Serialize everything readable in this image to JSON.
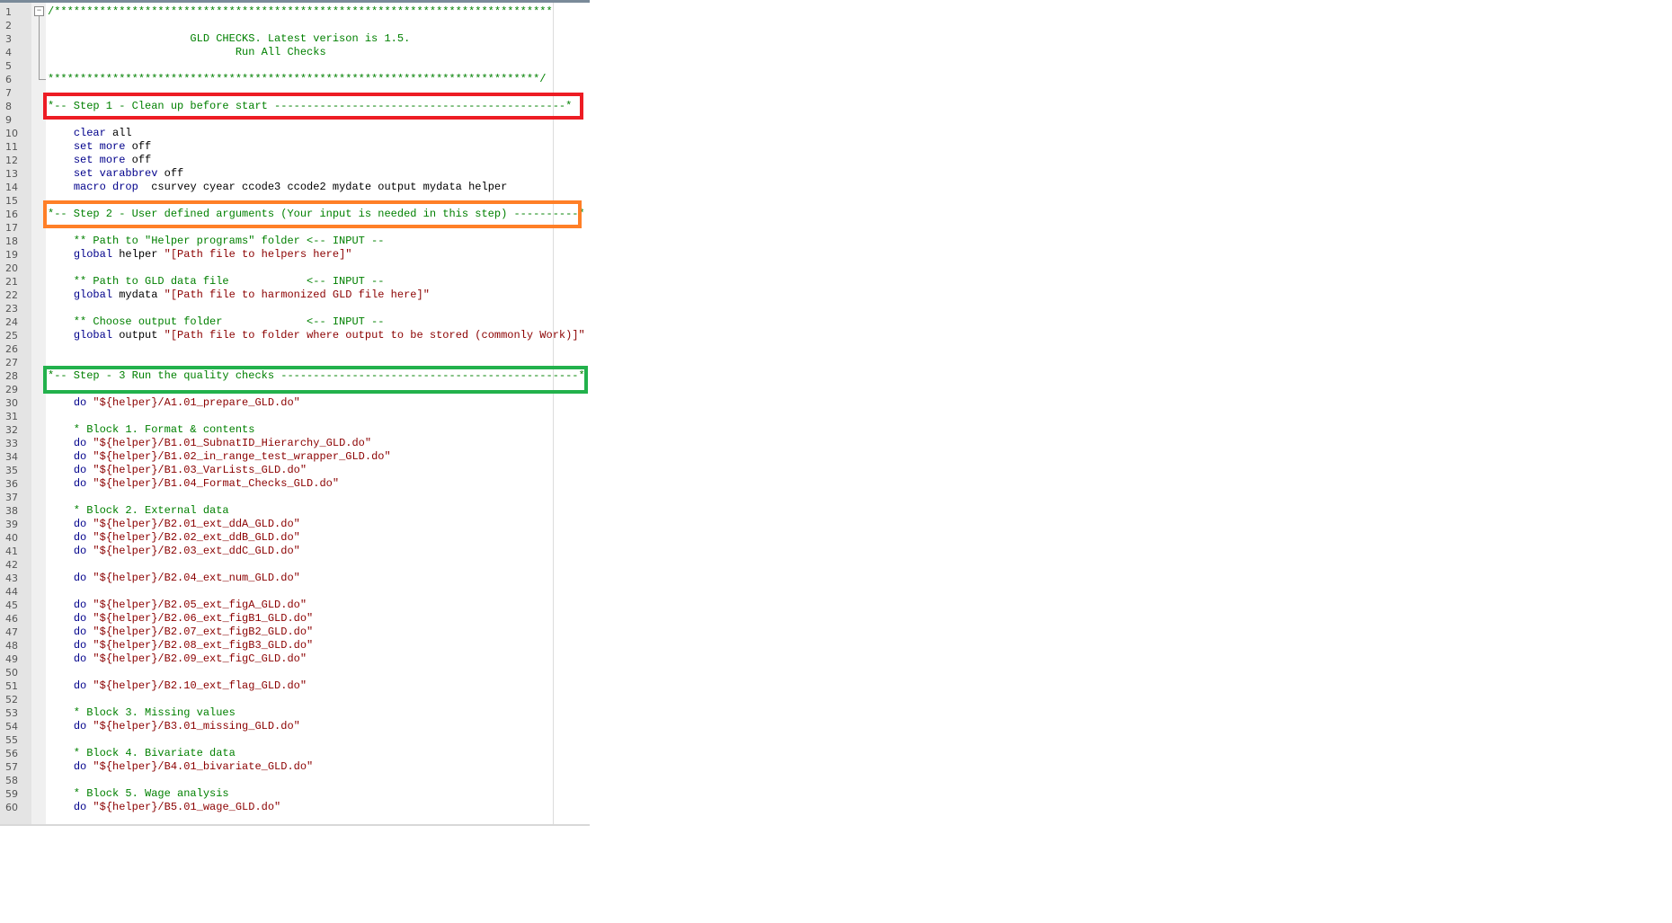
{
  "colors": {
    "comment": "#008000",
    "keyword": "#00008b",
    "string": "#8b0000",
    "step1_box": "#ed1c24",
    "step2_box": "#ff7f27",
    "step3_box": "#22b14c"
  },
  "lines": [
    [
      [
        "c",
        "/*****************************************************************************"
      ]
    ],
    [],
    [
      [
        "c",
        "                      GLD CHECKS. Latest verison is 1.5."
      ]
    ],
    [
      [
        "c",
        "                             Run All Checks"
      ]
    ],
    [],
    [
      [
        "c",
        "****************************************************************************/"
      ]
    ],
    [],
    [
      [
        "c",
        "*-- Step 1 - Clean up before start ---------------------------------------------*"
      ]
    ],
    [],
    [
      [
        "t",
        "    "
      ],
      [
        "k",
        "clear"
      ],
      [
        "t",
        " all"
      ]
    ],
    [
      [
        "t",
        "    "
      ],
      [
        "k",
        "set more"
      ],
      [
        "t",
        " off"
      ]
    ],
    [
      [
        "t",
        "    "
      ],
      [
        "k",
        "set more"
      ],
      [
        "t",
        " off"
      ]
    ],
    [
      [
        "t",
        "    "
      ],
      [
        "k",
        "set varabbrev"
      ],
      [
        "t",
        " off"
      ]
    ],
    [
      [
        "t",
        "    "
      ],
      [
        "k",
        "macro drop"
      ],
      [
        "t",
        "  csurvey cyear ccode3 ccode2 mydate output mydata helper"
      ]
    ],
    [],
    [
      [
        "c",
        "*-- Step 2 - User defined arguments (Your input is needed in this step) ----------*"
      ]
    ],
    [],
    [
      [
        "c",
        "    ** Path to \"Helper programs\" folder <-- INPUT --"
      ]
    ],
    [
      [
        "t",
        "    "
      ],
      [
        "k",
        "global"
      ],
      [
        "t",
        " helper "
      ],
      [
        "s",
        "\"[Path file to helpers here]\""
      ]
    ],
    [],
    [
      [
        "c",
        "    ** Path to GLD data file            <-- INPUT --"
      ]
    ],
    [
      [
        "t",
        "    "
      ],
      [
        "k",
        "global"
      ],
      [
        "t",
        " mydata "
      ],
      [
        "s",
        "\"[Path file to harmonized GLD file here]\""
      ]
    ],
    [],
    [
      [
        "c",
        "    ** Choose output folder             <-- INPUT --"
      ]
    ],
    [
      [
        "t",
        "    "
      ],
      [
        "k",
        "global"
      ],
      [
        "t",
        " output "
      ],
      [
        "s",
        "\"[Path file to folder where output to be stored (commonly Work)]\""
      ]
    ],
    [],
    [],
    [
      [
        "c",
        "*-- Step - 3 Run the quality checks ----------------------------------------------*"
      ]
    ],
    [],
    [
      [
        "t",
        "    "
      ],
      [
        "k",
        "do"
      ],
      [
        "t",
        " "
      ],
      [
        "s",
        "\"${helper}/A1.01_prepare_GLD.do\""
      ]
    ],
    [],
    [
      [
        "c",
        "    * Block 1. Format & contents"
      ]
    ],
    [
      [
        "t",
        "    "
      ],
      [
        "k",
        "do"
      ],
      [
        "t",
        " "
      ],
      [
        "s",
        "\"${helper}/B1.01_SubnatID_Hierarchy_GLD.do\""
      ]
    ],
    [
      [
        "t",
        "    "
      ],
      [
        "k",
        "do"
      ],
      [
        "t",
        " "
      ],
      [
        "s",
        "\"${helper}/B1.02_in_range_test_wrapper_GLD.do\""
      ]
    ],
    [
      [
        "t",
        "    "
      ],
      [
        "k",
        "do"
      ],
      [
        "t",
        " "
      ],
      [
        "s",
        "\"${helper}/B1.03_VarLists_GLD.do\""
      ]
    ],
    [
      [
        "t",
        "    "
      ],
      [
        "k",
        "do"
      ],
      [
        "t",
        " "
      ],
      [
        "s",
        "\"${helper}/B1.04_Format_Checks_GLD.do\""
      ]
    ],
    [],
    [
      [
        "c",
        "    * Block 2. External data"
      ]
    ],
    [
      [
        "t",
        "    "
      ],
      [
        "k",
        "do"
      ],
      [
        "t",
        " "
      ],
      [
        "s",
        "\"${helper}/B2.01_ext_ddA_GLD.do\""
      ]
    ],
    [
      [
        "t",
        "    "
      ],
      [
        "k",
        "do"
      ],
      [
        "t",
        " "
      ],
      [
        "s",
        "\"${helper}/B2.02_ext_ddB_GLD.do\""
      ]
    ],
    [
      [
        "t",
        "    "
      ],
      [
        "k",
        "do"
      ],
      [
        "t",
        " "
      ],
      [
        "s",
        "\"${helper}/B2.03_ext_ddC_GLD.do\""
      ]
    ],
    [],
    [
      [
        "t",
        "    "
      ],
      [
        "k",
        "do"
      ],
      [
        "t",
        " "
      ],
      [
        "s",
        "\"${helper}/B2.04_ext_num_GLD.do\""
      ]
    ],
    [],
    [
      [
        "t",
        "    "
      ],
      [
        "k",
        "do"
      ],
      [
        "t",
        " "
      ],
      [
        "s",
        "\"${helper}/B2.05_ext_figA_GLD.do\""
      ]
    ],
    [
      [
        "t",
        "    "
      ],
      [
        "k",
        "do"
      ],
      [
        "t",
        " "
      ],
      [
        "s",
        "\"${helper}/B2.06_ext_figB1_GLD.do\""
      ]
    ],
    [
      [
        "t",
        "    "
      ],
      [
        "k",
        "do"
      ],
      [
        "t",
        " "
      ],
      [
        "s",
        "\"${helper}/B2.07_ext_figB2_GLD.do\""
      ]
    ],
    [
      [
        "t",
        "    "
      ],
      [
        "k",
        "do"
      ],
      [
        "t",
        " "
      ],
      [
        "s",
        "\"${helper}/B2.08_ext_figB3_GLD.do\""
      ]
    ],
    [
      [
        "t",
        "    "
      ],
      [
        "k",
        "do"
      ],
      [
        "t",
        " "
      ],
      [
        "s",
        "\"${helper}/B2.09_ext_figC_GLD.do\""
      ]
    ],
    [],
    [
      [
        "t",
        "    "
      ],
      [
        "k",
        "do"
      ],
      [
        "t",
        " "
      ],
      [
        "s",
        "\"${helper}/B2.10_ext_flag_GLD.do\""
      ]
    ],
    [],
    [
      [
        "c",
        "    * Block 3. Missing values"
      ]
    ],
    [
      [
        "t",
        "    "
      ],
      [
        "k",
        "do"
      ],
      [
        "t",
        " "
      ],
      [
        "s",
        "\"${helper}/B3.01_missing_GLD.do\""
      ]
    ],
    [],
    [
      [
        "c",
        "    * Block 4. Bivariate data"
      ]
    ],
    [
      [
        "t",
        "    "
      ],
      [
        "k",
        "do"
      ],
      [
        "t",
        " "
      ],
      [
        "s",
        "\"${helper}/B4.01_bivariate_GLD.do\""
      ]
    ],
    [],
    [
      [
        "c",
        "    * Block 5. Wage analysis"
      ]
    ],
    [
      [
        "t",
        "    "
      ],
      [
        "k",
        "do"
      ],
      [
        "t",
        " "
      ],
      [
        "s",
        "\"${helper}/B5.01_wage_GLD.do\""
      ]
    ]
  ]
}
